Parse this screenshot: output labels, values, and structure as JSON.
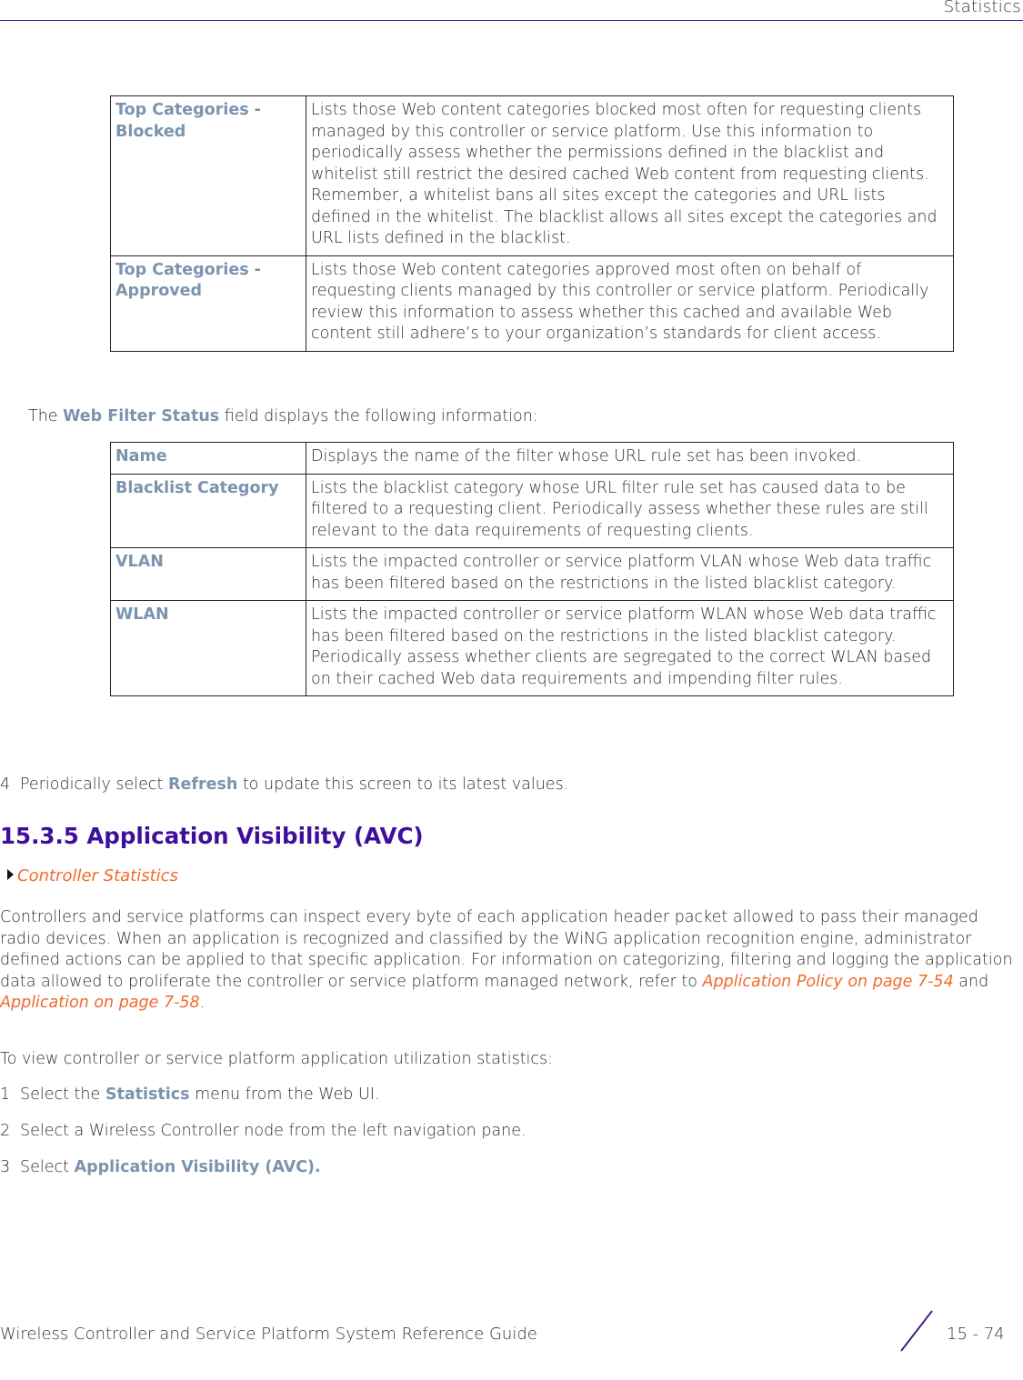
{
  "header": {
    "title": "Statistics"
  },
  "table_top": {
    "rows": [
      {
        "term": "Top Categories - Blocked",
        "desc": "Lists those Web content categories blocked most often for requesting clients managed by this controller or service platform. Use this information to periodically assess whether the permissions defined in the blacklist and whitelist still restrict the desired cached Web content from requesting clients. Remember, a whitelist bans all sites except the categories and URL lists defined in the whitelist. The blacklist allows all sites except the categories and URL lists defined in the blacklist."
      },
      {
        "term": "Top Categories - Approved",
        "desc": "Lists those Web content categories approved most often on behalf of requesting clients managed by this controller or service platform. Periodically review this information to assess whether this cached and available Web content still adhere’s to your organization’s standards for client access."
      }
    ]
  },
  "web_filter_intro": {
    "prefix": "The ",
    "term": "Web Filter Status",
    "suffix": " field displays the following information:"
  },
  "table_filter": {
    "rows": [
      {
        "term": "Name",
        "desc": "Displays the name of the filter whose URL rule set has been invoked."
      },
      {
        "term": "Blacklist Category",
        "desc": "Lists the blacklist category whose URL filter rule set has caused data to be filtered to a requesting client. Periodically assess whether these rules are still relevant to the data requirements of requesting clients."
      },
      {
        "term": "VLAN",
        "desc": "Lists the impacted controller or service platform VLAN whose Web data traffic has been filtered based on the restrictions in the listed blacklist category."
      },
      {
        "term": "WLAN",
        "desc": "Lists the impacted controller or service platform WLAN whose Web data traffic has been filtered based on the restrictions in the listed blacklist category. Periodically assess whether clients are segregated to the correct WLAN based on their cached Web data requirements and impending filter rules."
      }
    ]
  },
  "step4": {
    "num": "4",
    "prefix": "Periodically select ",
    "term": "Refresh",
    "suffix": " to update this screen to its latest values."
  },
  "section": {
    "heading": "15.3.5 Application Visibility (AVC)",
    "breadcrumb": "Controller Statistics",
    "para1_text": "Controllers and service platforms can inspect every byte of each application header packet allowed to pass their managed radio devices. When an application is recognized and classified by the WiNG application recognition engine, administrator defined actions can be applied to that specific application. For information on categorizing, filtering and logging the application data allowed to proliferate the controller or service platform managed network, refer to ",
    "link1": "Application Policy on page 7-54",
    "and": " and ",
    "link2": "Application on page 7-58",
    "period": ".",
    "para2": "To view controller or service platform application utilization statistics:",
    "steps": [
      {
        "num": "1",
        "prefix": "Select the ",
        "term": "Statistics",
        "suffix": " menu from the Web UI."
      },
      {
        "num": "2",
        "prefix": "Select a Wireless Controller node from the left navigation pane.",
        "term": "",
        "suffix": ""
      },
      {
        "num": "3",
        "prefix": "Select ",
        "term": "Application Visibility (AVC).",
        "suffix": ""
      }
    ]
  },
  "footer": {
    "guide_title": "Wireless Controller and Service Platform System Reference Guide",
    "page": "15 - 74"
  }
}
